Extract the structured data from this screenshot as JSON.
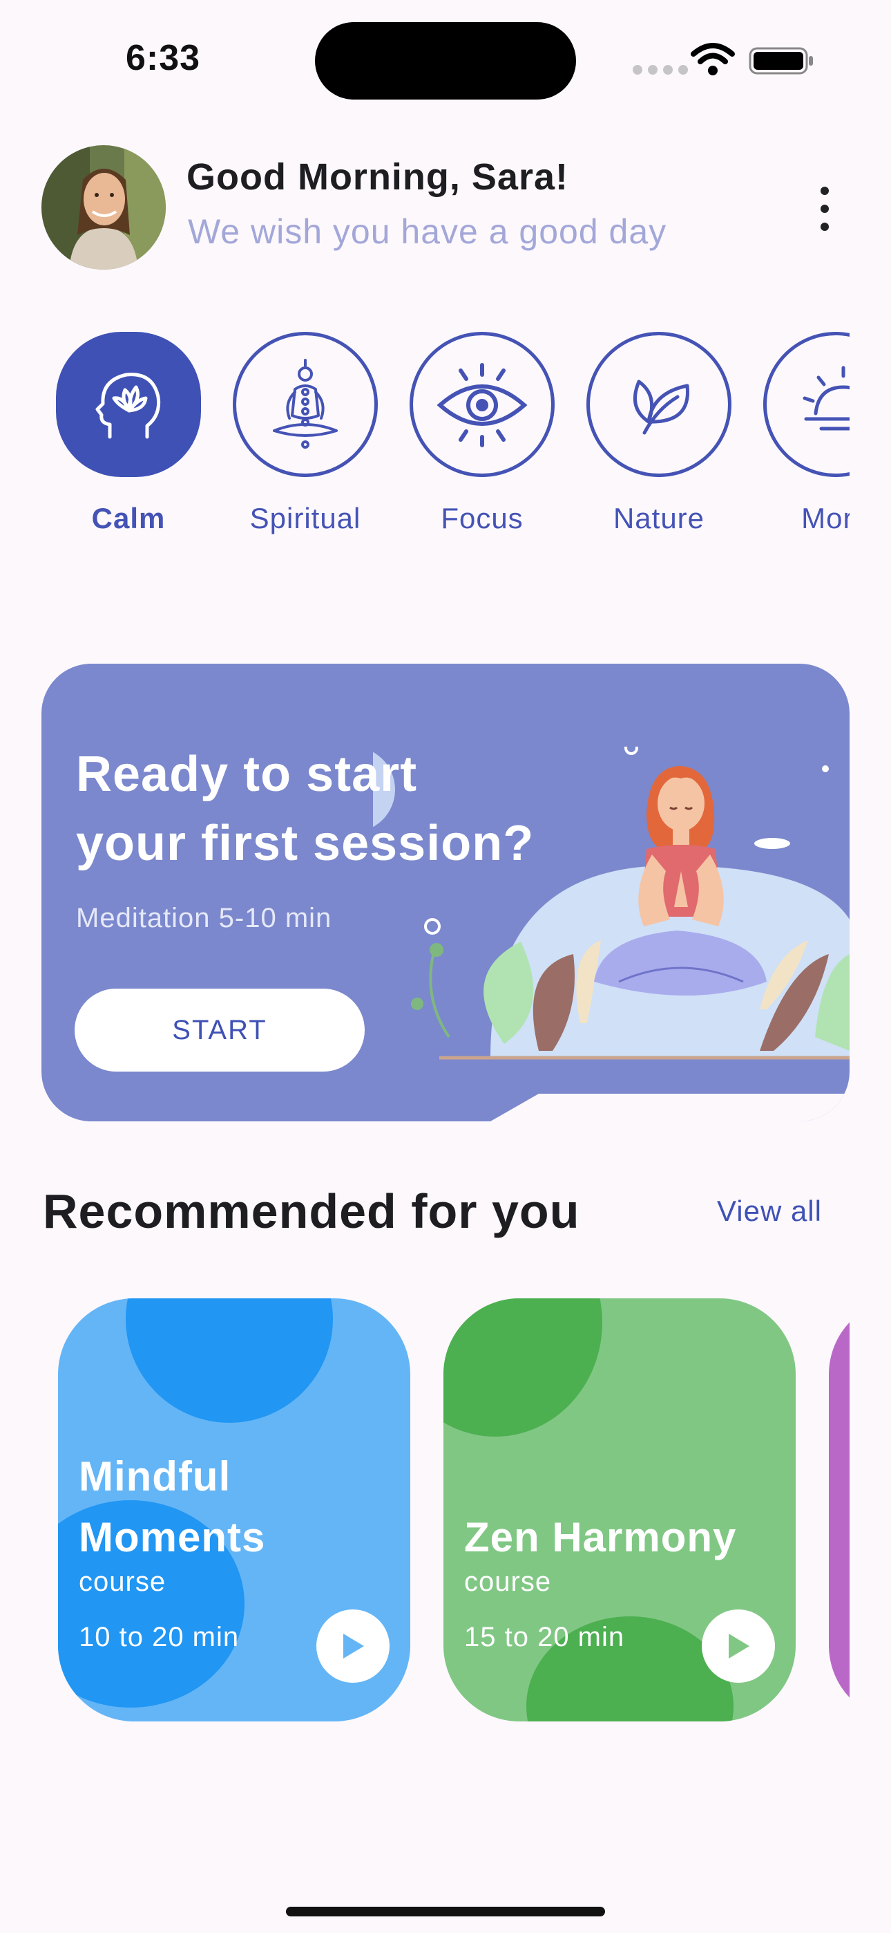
{
  "status_bar": {
    "time": "6:33"
  },
  "header": {
    "greeting": "Good Morning, Sara!",
    "subtitle": "We wish you have a good day"
  },
  "categories": [
    {
      "label": "Calm",
      "icon": "head-lotus-icon",
      "active": true
    },
    {
      "label": "Spiritual",
      "icon": "meditation-chakra-icon",
      "active": false
    },
    {
      "label": "Focus",
      "icon": "eye-icon",
      "active": false
    },
    {
      "label": "Nature",
      "icon": "leaf-icon",
      "active": false
    },
    {
      "label": "Morn",
      "icon": "sunrise-icon",
      "active": false
    }
  ],
  "banner": {
    "title_line1": "Ready to start",
    "title_line2": "your first session?",
    "subtitle": "Meditation 5-10 min",
    "button_label": "START"
  },
  "recommended": {
    "title": "Recommended for you",
    "view_all": "View all",
    "cards": [
      {
        "title_line1": "Mindful",
        "title_line2": "Moments",
        "kind": "course",
        "duration": "10 to 20 min",
        "color": "#64b5f6"
      },
      {
        "title_line1": "",
        "title_line2": "Zen Harmony",
        "kind": "course",
        "duration": "15 to 20 min",
        "color": "#81c784"
      }
    ]
  },
  "colors": {
    "accent": "#3f51b5",
    "banner_bg": "#7b88cd",
    "background": "#fcf8fc",
    "card_blue": "#64b5f6",
    "card_green": "#81c784",
    "card_purple": "#ba68c8"
  }
}
